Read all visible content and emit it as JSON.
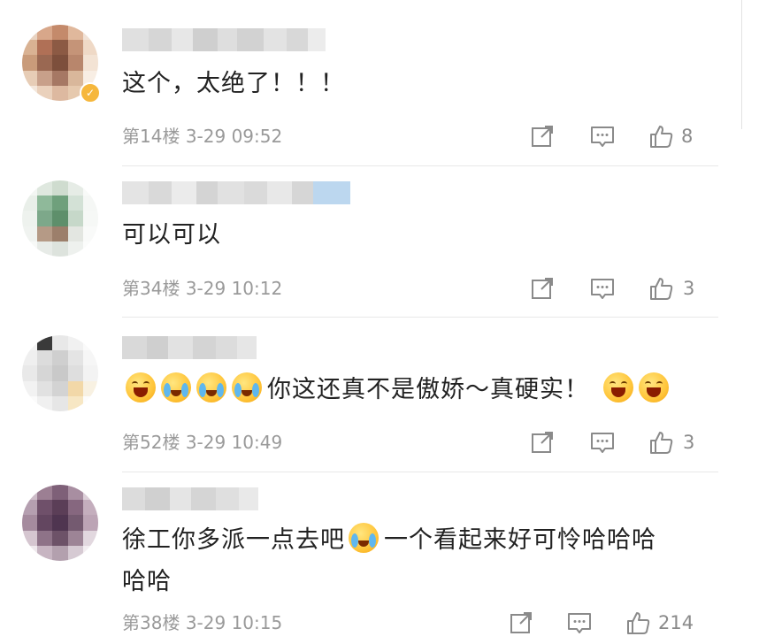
{
  "comments": [
    {
      "content": "这个，太绝了！！！",
      "floor": "第14楼",
      "date": "3-29",
      "time": "09:52",
      "likes": "8",
      "avatar_colors": [
        "#e9d3c1",
        "#d8a78a",
        "#c48a6b",
        "#e0b89c",
        "#f1e2d6",
        "#d9b293",
        "#b07056",
        "#8c5a44",
        "#c59478",
        "#efd9c6",
        "#c99b7a",
        "#9a6852",
        "#7d4f3c",
        "#b8866c",
        "#f3e3d4",
        "#e7cdb6",
        "#c8a08a",
        "#a67864",
        "#d9b79b",
        "#f8eee4",
        "#f4e7db",
        "#ead1bc",
        "#ddb9a0",
        "#e6c9ae",
        "#fbf4ec"
      ]
    },
    {
      "content": "可以可以",
      "floor": "第34楼",
      "date": "3-29",
      "time": "10:12",
      "likes": "3",
      "avatar_colors": [
        "#f3f6f3",
        "#dfe8df",
        "#cfdccf",
        "#e6ece6",
        "#f8faf8",
        "#e9efe9",
        "#8fb99a",
        "#6fa07c",
        "#d3e1d6",
        "#f5f7f5",
        "#eef2ee",
        "#7da88a",
        "#5e8f6b",
        "#c6d8c9",
        "#f6f8f6",
        "#f0f3f0",
        "#b59a86",
        "#9c7f6b",
        "#e3e6e1",
        "#f9faf9",
        "#f7f9f7",
        "#e7ebe7",
        "#dde3dd",
        "#eef1ee",
        "#fbfcfb"
      ]
    },
    {
      "content_emojis_before": [
        "laugh-tear-emoji",
        "cry-emoji",
        "cry-emoji",
        "cry-emoji"
      ],
      "content": "你这还真不是傲娇～真硬实！",
      "content_emojis_after": [
        "laugh-tear-emoji",
        "laugh-emoji"
      ],
      "floor": "第52楼",
      "date": "3-29",
      "time": "10:49",
      "likes": "3",
      "avatar_colors": [
        "#f4f4f4",
        "#3a3a3a",
        "#e8e8e8",
        "#f1f1f1",
        "#fafafa",
        "#efefef",
        "#dcdcdc",
        "#cfcfcf",
        "#e4e4e4",
        "#f6f6f6",
        "#e9e9e9",
        "#d6d6d6",
        "#c9c9c9",
        "#dedede",
        "#f3f3f3",
        "#f2f2f2",
        "#e1e1e1",
        "#d3d3d3",
        "#f2d8a8",
        "#f8f1e2",
        "#fbfbfb",
        "#f0f0f0",
        "#e6e6e6",
        "#f7e7c4",
        "#fcfcfc"
      ]
    },
    {
      "content_line1": "徐工你多派一点去吧",
      "content_emoji_mid": "cry-emoji",
      "content_line1_after": "一个看起来好可怜哈哈哈",
      "content_line2": "哈哈",
      "floor": "第38楼",
      "date": "3-29",
      "time": "10:15",
      "likes": "214",
      "avatar_colors": [
        "#cdbcc8",
        "#9c7f93",
        "#7e6078",
        "#a88ea1",
        "#dccfd8",
        "#b59fb0",
        "#6f506a",
        "#5b3e57",
        "#86677f",
        "#c4aebd",
        "#a58b9e",
        "#634660",
        "#4f3550",
        "#745a70",
        "#bca4b5",
        "#d5c6d0",
        "#8e7388",
        "#6d5268",
        "#9d8496",
        "#e2d8df",
        "#efe9ed",
        "#c7b5c2",
        "#b3a0ae",
        "#d6cad3",
        "#f3eef1"
      ]
    }
  ],
  "actions": {
    "share_icon": "share-icon",
    "comment_icon": "comment-icon",
    "like_icon": "thumbs-up-icon"
  },
  "colors": {
    "meta_text": "#9a9a9a",
    "content_text": "#222222",
    "vip_badge": "#f6b73c"
  }
}
